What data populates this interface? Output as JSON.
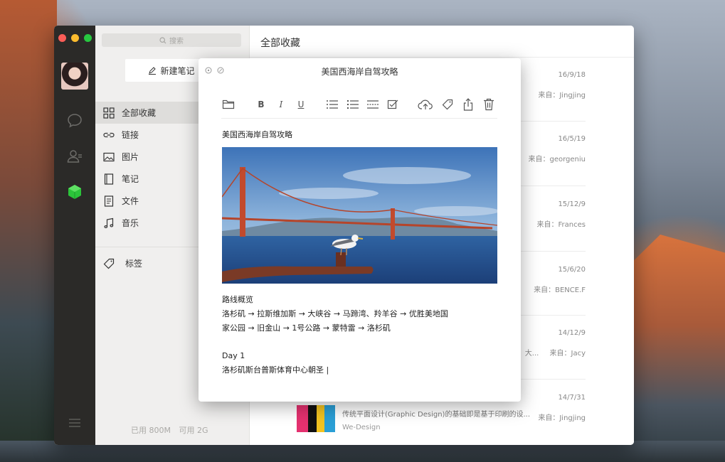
{
  "sidebar": {
    "search_placeholder": "搜索",
    "new_note_label": "新建笔记",
    "items": [
      {
        "label": "全部收藏",
        "icon": "grid-icon"
      },
      {
        "label": "链接",
        "icon": "link-icon"
      },
      {
        "label": "图片",
        "icon": "image-icon"
      },
      {
        "label": "笔记",
        "icon": "notebook-icon"
      },
      {
        "label": "文件",
        "icon": "file-icon"
      },
      {
        "label": "音乐",
        "icon": "music-icon"
      }
    ],
    "tags_label": "标签",
    "storage_used": "已用 800M",
    "storage_available": "可用 2G"
  },
  "list": {
    "header": "全部收藏",
    "rows": [
      {
        "date": "16/9/18",
        "source": "来自：Jingjing"
      },
      {
        "date": "16/5/19",
        "source": "来自：georgeniu"
      },
      {
        "date": "15/12/9",
        "source": "来自：Frances"
      },
      {
        "date": "15/6/20",
        "source": "来自：BENCE.F"
      },
      {
        "date": "14/12/9",
        "source": "来自：Jacy",
        "snippet_tail": "大..."
      },
      {
        "date": "14/7/31",
        "source": "来自：Jingjing",
        "snippet": "传统平面设计(Graphic Design)的基础即是基于印刷的设...",
        "origin": "We-Design"
      }
    ]
  },
  "note": {
    "window_title": "美国西海岸自驾攻略",
    "heading": "美国西海岸自驾攻略",
    "toolbar": {
      "bold": "B",
      "italic": "I",
      "underline": "U"
    },
    "body": {
      "route_title": "路线概览",
      "route_line1": "洛杉矶 → 拉斯维加斯 → 大峡谷 → 马蹄湾、羚羊谷 → 优胜美地国",
      "route_line2": "家公园 → 旧金山 → 1号公路 → 蒙特雷 → 洛杉矶",
      "day_label": "Day 1",
      "day_text": "洛杉矶斯台普斯体育中心朝圣 |"
    }
  },
  "colors": {
    "rail_bg": "#2b2a28",
    "sidebar_bg": "#f0efee",
    "active_item_bg": "#dedddb",
    "accent_green": "#2bc43a"
  }
}
